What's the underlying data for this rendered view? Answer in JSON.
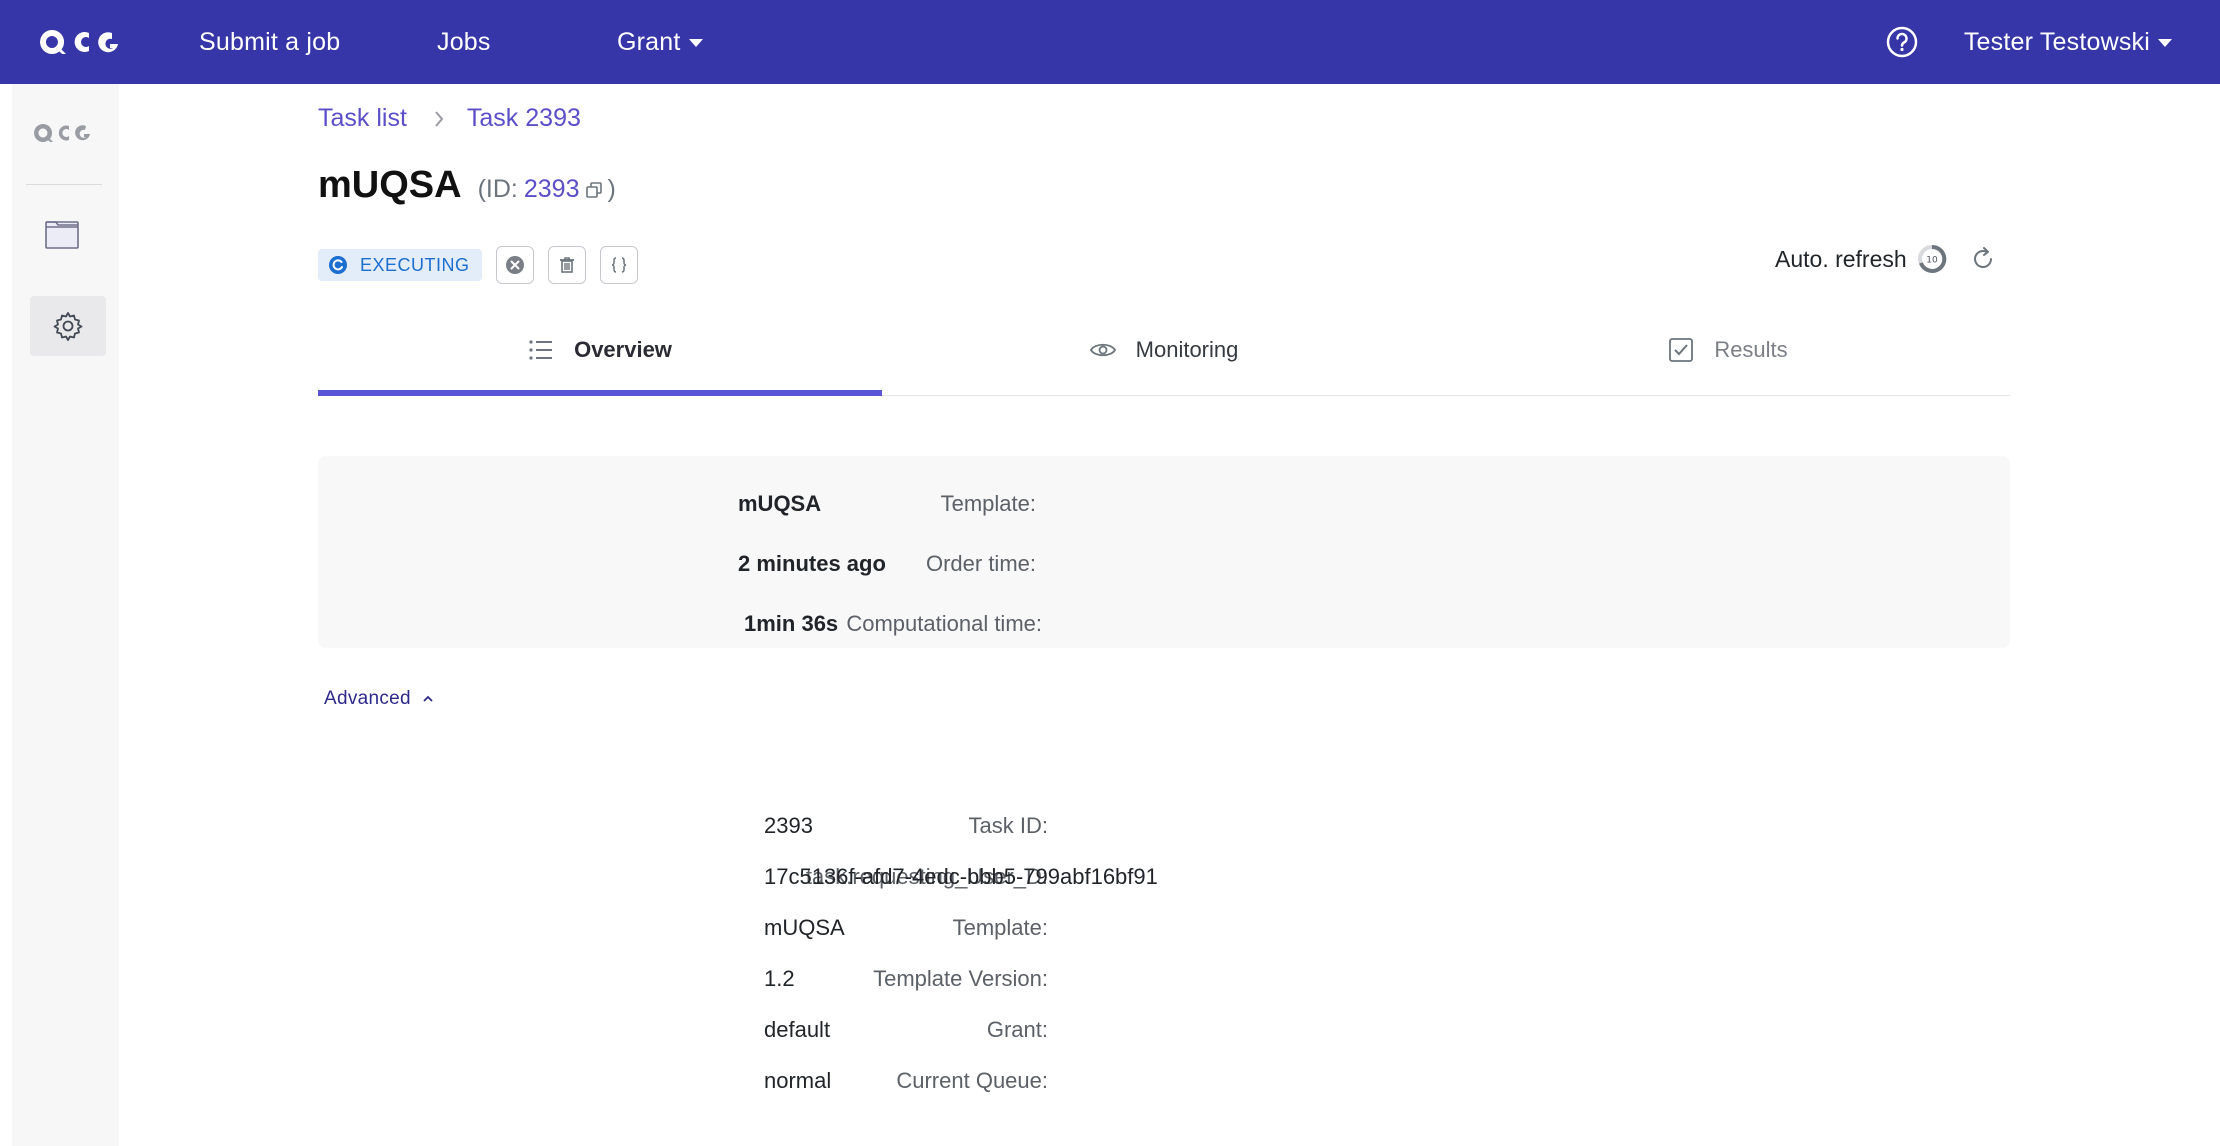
{
  "navbar": {
    "brand": "QCG",
    "submit_job": "Submit a job",
    "jobs": "Jobs",
    "grant": "Grant",
    "user": "Tester Testowski"
  },
  "sidebar": {
    "logo": "QCG",
    "items": [
      {
        "icon": "folder-icon"
      },
      {
        "icon": "gear-icon"
      }
    ]
  },
  "breadcrumb": {
    "task_list": "Task list",
    "current": "Task 2393"
  },
  "task": {
    "name": "mUQSA",
    "id_prefix": "(ID:",
    "id": "2393",
    "id_suffix": ")",
    "status": "EXECUTING",
    "status_color": "#1a6fd0"
  },
  "auto_refresh": {
    "label": "Auto. refresh",
    "seconds": "10"
  },
  "tabs": [
    {
      "label": "Overview",
      "active": true
    },
    {
      "label": "Monitoring",
      "active": false
    },
    {
      "label": "Results",
      "active": false
    }
  ],
  "overview": {
    "template_label": "Template:",
    "template_value": "mUQSA",
    "order_time_label": "Order time:",
    "order_time_value": "2 minutes ago",
    "comp_time_label": "Computational time:",
    "comp_time_value": "1min 36s"
  },
  "advanced": {
    "toggle_label": "Advanced",
    "rows": [
      {
        "label": "Task ID:",
        "value": "2393"
      },
      {
        "label": "task.requesting_User_D:",
        "value": "17c5136f-afd7-4edc-bbb5-799abf16bf91"
      },
      {
        "label": "Template:",
        "value": "mUQSA"
      },
      {
        "label": "Template Version:",
        "value": "1.2"
      },
      {
        "label": "Grant:",
        "value": "default"
      },
      {
        "label": "Current Queue:",
        "value": "normal"
      }
    ]
  },
  "colors": {
    "navbar": "#3636a8",
    "accent": "#5a55d6",
    "link": "#5a4fc9"
  }
}
